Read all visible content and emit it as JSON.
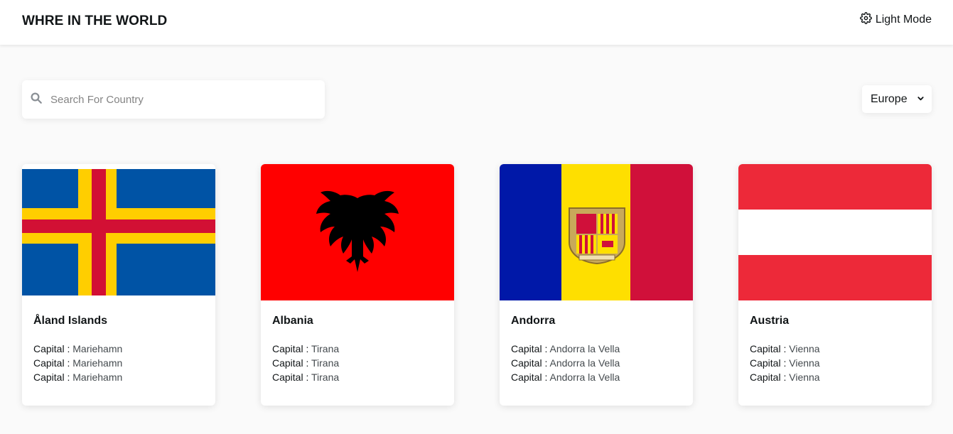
{
  "header": {
    "title": "WHRE IN THE WORLD",
    "theme_label": "Light Mode",
    "theme_icon": "gear-icon"
  },
  "search": {
    "placeholder": "Search For Country",
    "value": "",
    "icon": "search-icon"
  },
  "filter": {
    "selected": "Europe",
    "icon": "chevron-down-icon"
  },
  "colors": {
    "background": "#fafafa",
    "card": "#ffffff",
    "text": "#111517"
  },
  "countries": [
    {
      "name": "Åland Islands",
      "lines": [
        {
          "label": "Capital : ",
          "value": "Mariehamn"
        },
        {
          "label": "Capital : ",
          "value": "Mariehamn"
        },
        {
          "label": "Capital : ",
          "value": "Mariehamn"
        }
      ]
    },
    {
      "name": "Albania",
      "lines": [
        {
          "label": "Capital : ",
          "value": "Tirana"
        },
        {
          "label": "Capital : ",
          "value": "Tirana"
        },
        {
          "label": "Capital : ",
          "value": "Tirana"
        }
      ]
    },
    {
      "name": "Andorra",
      "lines": [
        {
          "label": "Capital : ",
          "value": "Andorra la Vella"
        },
        {
          "label": "Capital : ",
          "value": "Andorra la Vella"
        },
        {
          "label": "Capital : ",
          "value": "Andorra la Vella"
        }
      ]
    },
    {
      "name": "Austria",
      "lines": [
        {
          "label": "Capital : ",
          "value": "Vienna"
        },
        {
          "label": "Capital : ",
          "value": "Vienna"
        },
        {
          "label": "Capital : ",
          "value": "Vienna"
        }
      ]
    }
  ]
}
